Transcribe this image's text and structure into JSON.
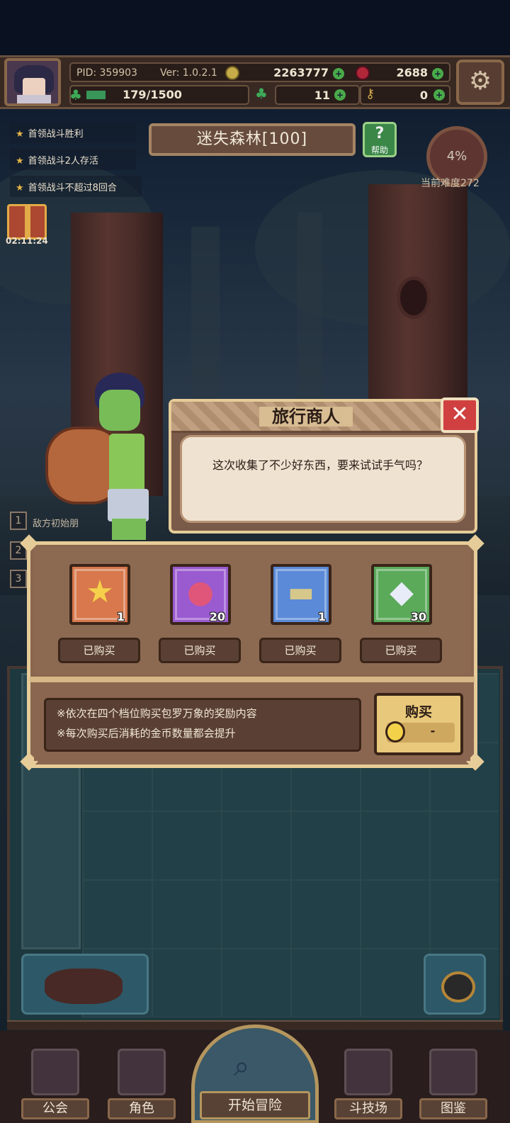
{
  "player": {
    "pid": "PID: 359903",
    "version": "Ver: 1.0.2.1",
    "gold": "2263777",
    "gems": "2688",
    "stamina": "179/1500",
    "stamina_fraction": 0.119,
    "clovers": "11",
    "keys": "0"
  },
  "quests": [
    "首领战斗胜利",
    "首领战斗2人存活",
    "首领战斗不超过8回合"
  ],
  "gift_timer": "02:11:24",
  "stage": {
    "title": "迷失森林[100]",
    "help_label": "帮助",
    "progress": "4%",
    "difficulty_label": "当前难度272"
  },
  "hints": {
    "hint1": "敌方初始朋",
    "numbers": [
      "1",
      "2",
      "3"
    ]
  },
  "merchant": {
    "title": "旅行商人",
    "message": "这次收集了不少好东西，要来试试手气吗？",
    "items": [
      {
        "icon": "star-icon",
        "qty": "1",
        "status": "已购买",
        "color": "orange"
      },
      {
        "icon": "fruit-icon",
        "qty": "20",
        "status": "已购买",
        "color": "purple"
      },
      {
        "icon": "chest-icon",
        "qty": "1",
        "status": "已购买",
        "color": "blue"
      },
      {
        "icon": "crystal-icon",
        "qty": "30",
        "status": "已购买",
        "color": "green"
      }
    ],
    "notes": [
      "※依次在四个档位购买包罗万象的奖励内容",
      "※每次购买后消耗的金币数量都会提升"
    ],
    "buy_label": "购买",
    "buy_price": "-"
  },
  "nav": {
    "guild": "公会",
    "character": "角色",
    "adventure": "开始冒险",
    "arena": "斗技场",
    "codex": "图鉴"
  },
  "colors": {
    "accent": "#e6cc98",
    "panel": "#8a6650",
    "close": "#d04040",
    "buy": "#e8c87a"
  }
}
